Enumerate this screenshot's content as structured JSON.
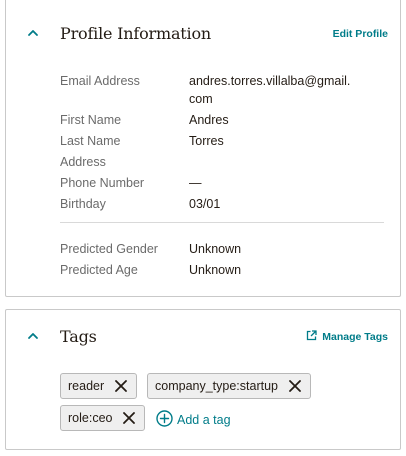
{
  "profile": {
    "title": "Profile Information",
    "edit_label": "Edit Profile",
    "rows": [
      {
        "label": "Email Address",
        "value": "andres.torres.villalba@gmail.",
        "value_line2": "com"
      },
      {
        "label": "First Name",
        "value": "Andres"
      },
      {
        "label": "Last Name",
        "value": "Torres"
      },
      {
        "label": "Address",
        "value": ""
      },
      {
        "label": "Phone Number",
        "value": "—"
      },
      {
        "label": "Birthday",
        "value": "03/01"
      }
    ],
    "predicted": [
      {
        "label": "Predicted Gender",
        "value": "Unknown"
      },
      {
        "label": "Predicted Age",
        "value": "Unknown"
      }
    ]
  },
  "tags_section": {
    "title": "Tags",
    "manage_label": "Manage Tags",
    "tags": [
      "reader",
      "company_type:startup",
      "role:ceo"
    ],
    "add_label": "Add a tag"
  },
  "colors": {
    "accent": "#007c89",
    "label": "#6b6b6b",
    "text": "#241c15",
    "tag_bg": "#efefef",
    "border": "#c9c9c9"
  },
  "icons": {
    "collapse": "chevron-up-icon",
    "remove": "close-icon",
    "add": "plus-circle-icon",
    "external": "external-link-icon"
  }
}
